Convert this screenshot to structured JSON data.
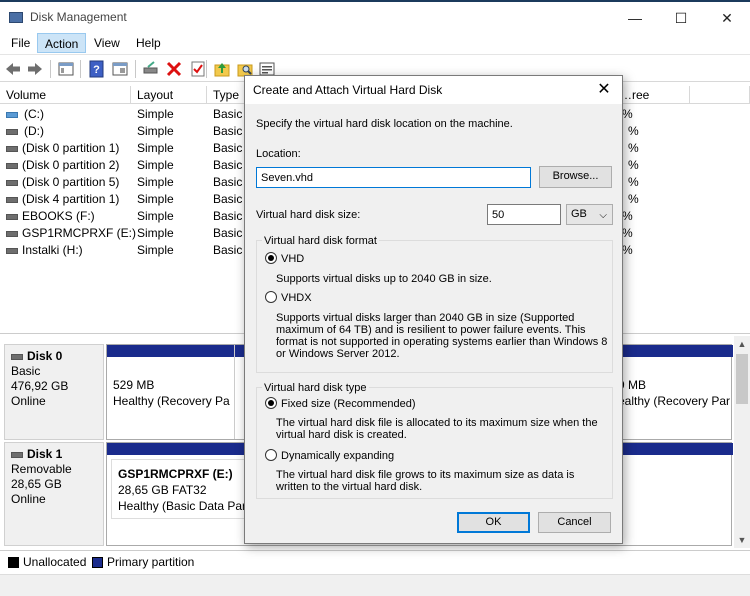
{
  "window": {
    "title": "Disk Management",
    "minimize_glyph": "—",
    "maximize_glyph": "☐",
    "close_glyph": "✕"
  },
  "menu": {
    "items": [
      "File",
      "Action",
      "View",
      "Help"
    ],
    "active": "Action"
  },
  "volume_list": {
    "columns": [
      "Volume",
      "Layout",
      "Type",
      "…ree"
    ],
    "rows": [
      {
        "volume": "(C:)",
        "layout": "Simple",
        "type": "Basic",
        "free": "%"
      },
      {
        "volume": "(D:)",
        "layout": "Simple",
        "type": "Basic",
        "free": "%"
      },
      {
        "volume": "(Disk 0 partition 1)",
        "layout": "Simple",
        "type": "Basic",
        "free": "%"
      },
      {
        "volume": "(Disk 0 partition 2)",
        "layout": "Simple",
        "type": "Basic",
        "free": "%"
      },
      {
        "volume": "(Disk 0 partition 5)",
        "layout": "Simple",
        "type": "Basic",
        "free": "%"
      },
      {
        "volume": "(Disk 4 partition 1)",
        "layout": "Simple",
        "type": "Basic",
        "free": "%"
      },
      {
        "volume": "EBOOKS (F:)",
        "layout": "Simple",
        "type": "Basic",
        "free": "%"
      },
      {
        "volume": "GSP1RMCPRXF (E:)",
        "layout": "Simple",
        "type": "Basic",
        "free": "%"
      },
      {
        "volume": "Instalki (H:)",
        "layout": "Simple",
        "type": "Basic",
        "free": "%"
      }
    ]
  },
  "disks": [
    {
      "name": "Disk 0",
      "type": "Basic",
      "size": "476,92 GB",
      "status": "Online",
      "partitions": [
        {
          "line1": "529 MB",
          "line2": "Healthy (Recovery Pa"
        },
        {
          "line1": "9 MB",
          "line2": "ealthy (Recovery Par"
        }
      ]
    },
    {
      "name": "Disk 1",
      "type": "Removable",
      "size": "28,65 GB",
      "status": "Online",
      "partitions": [
        {
          "line0": "GSP1RMCPRXF  (E:)",
          "line1": "28,65 GB FAT32",
          "line2": "Healthy (Basic Data Parti"
        }
      ]
    }
  ],
  "legend": {
    "unallocated": "Unallocated",
    "primary": "Primary partition",
    "unallocated_color": "#000000",
    "primary_color": "#1a2b8c"
  },
  "dialog": {
    "title": "Create and Attach Virtual Hard Disk",
    "close_glyph": "✕",
    "intro": "Specify the virtual hard disk location on the machine.",
    "location_label": "Location:",
    "location_value": "Seven.vhd",
    "browse_label": "Browse...",
    "size_label": "Virtual hard disk size:",
    "size_value": "50",
    "size_unit": "GB",
    "format_group": "Virtual hard disk format",
    "format_options": [
      {
        "label": "VHD",
        "desc": "Supports virtual disks up to 2040 GB in size.",
        "selected": true
      },
      {
        "label": "VHDX",
        "desc": "Supports virtual disks larger than 2040 GB in size (Supported maximum of 64 TB) and is resilient to power failure events. This format is not supported in operating systems earlier than Windows 8 or Windows Server 2012.",
        "selected": false
      }
    ],
    "type_group": "Virtual hard disk type",
    "type_options": [
      {
        "label": "Fixed size (Recommended)",
        "desc": "The virtual hard disk file is allocated to its maximum size when the virtual hard disk is created.",
        "selected": true
      },
      {
        "label": "Dynamically expanding",
        "desc": "The virtual hard disk file grows to its maximum size as data is written to the virtual hard disk.",
        "selected": false
      }
    ],
    "ok_label": "OK",
    "cancel_label": "Cancel"
  }
}
